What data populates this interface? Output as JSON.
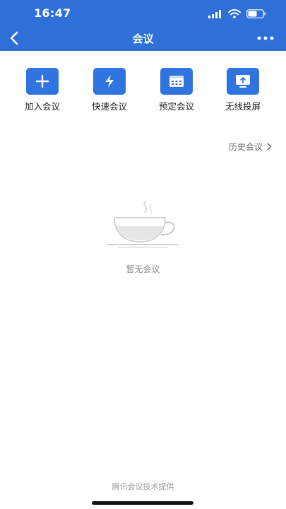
{
  "status_bar": {
    "time": "16:47"
  },
  "nav": {
    "title": "会议"
  },
  "actions": [
    {
      "label": "加入会议",
      "icon": "plus-icon"
    },
    {
      "label": "快速会议",
      "icon": "lightning-icon"
    },
    {
      "label": "预定会议",
      "icon": "calendar-icon"
    },
    {
      "label": "无线投屏",
      "icon": "screen-cast-icon"
    }
  ],
  "history": {
    "label": "历史会议"
  },
  "empty": {
    "text": "暂无会议",
    "icon": "coffee-cup-icon"
  },
  "footer": {
    "text": "腾讯会议技术提供"
  },
  "colors": {
    "header": "#2f6fd8",
    "action_icon_bg": "#2f74e0"
  }
}
